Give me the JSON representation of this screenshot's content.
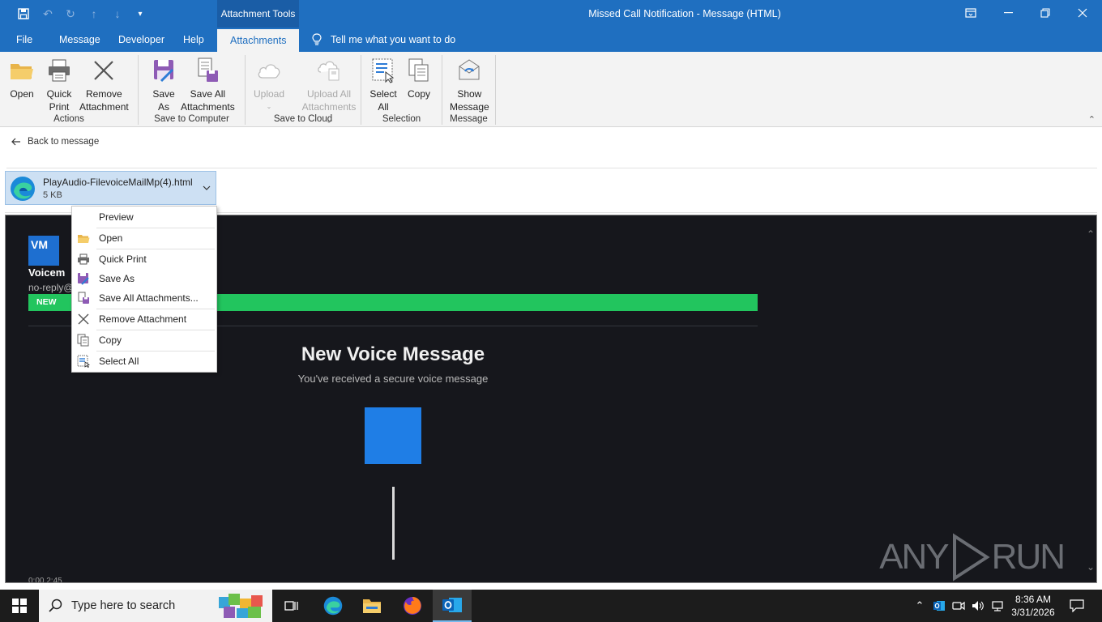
{
  "titlebar": {
    "context_tab": "Attachment Tools",
    "window_title": "Missed Call Notification  -  Message (HTML)"
  },
  "menu_tabs": [
    "File",
    "Message",
    "Developer",
    "Help",
    "Attachments"
  ],
  "tell_me": "Tell me what you want to do",
  "ribbon": {
    "actions": {
      "label": "Actions",
      "open": "Open",
      "quick_print_1": "Quick",
      "quick_print_2": "Print",
      "remove_1": "Remove",
      "remove_2": "Attachment"
    },
    "save_computer": {
      "label": "Save to Computer",
      "save_as_1": "Save",
      "save_as_2": "As",
      "save_all_1": "Save All",
      "save_all_2": "Attachments"
    },
    "save_cloud": {
      "label": "Save to Cloud",
      "upload": "Upload",
      "upload_all_1": "Upload All",
      "upload_all_2": "Attachments"
    },
    "selection": {
      "label": "Selection",
      "select_all_1": "Select",
      "select_all_2": "All",
      "copy": "Copy"
    },
    "message": {
      "label": "Message",
      "show_1": "Show",
      "show_2": "Message"
    }
  },
  "back_link": "Back to message",
  "attachment": {
    "name": "PlayAudio-FilevoiceMailMp(4).html",
    "size": "5 KB"
  },
  "preview": {
    "avatar_text": "VM",
    "sender_name": "Voicem",
    "sender_addr": "no-reply@",
    "new_badge": "NEW",
    "title": "New Voice Message",
    "subtitle": "You've received a secure voice message",
    "duration": "0:00 2:45",
    "watermark": "ANY RUN",
    "accent_color": "#22c55e",
    "play_color": "#1f7ee6"
  },
  "context_menu": [
    {
      "label": "Preview",
      "icon": "none"
    },
    {
      "label": "Open",
      "icon": "folder-icon"
    },
    {
      "label": "Quick Print",
      "icon": "printer-icon"
    },
    {
      "label": "Save As",
      "icon": "save-as-icon"
    },
    {
      "label": "Save All Attachments...",
      "icon": "save-all-icon"
    },
    {
      "label": "Remove Attachment",
      "icon": "close-icon"
    },
    {
      "label": "Copy",
      "icon": "copy-icon"
    },
    {
      "label": "Select All",
      "icon": "select-all-icon"
    }
  ],
  "taskbar": {
    "search_placeholder": "Type here to search",
    "time": "8:36 AM",
    "date": "3/31/2026"
  }
}
